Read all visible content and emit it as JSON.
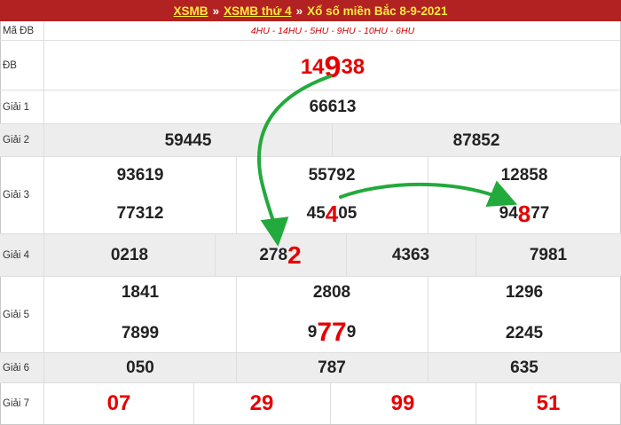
{
  "breadcrumb": {
    "home": "XSMB",
    "sep1": "»",
    "category": "XSMB thứ 4",
    "sep2": "»",
    "current": "Xổ số miền Bắc 8-9-2021"
  },
  "table": {
    "ma_db_label": "Mã ĐB",
    "ma_db_codes": "4HU - 14HU - 5HU - 9HU - 10HU - 6HU",
    "db_label": "ĐB",
    "db": {
      "pre": "14",
      "hl": "9",
      "post": "38"
    },
    "g1_label": "Giải 1",
    "g1": "66613",
    "g2_label": "Giải 2",
    "g2": [
      "59445",
      "87852"
    ],
    "g3_label": "Giải 3",
    "g3_row1": [
      "93619",
      "55792",
      "12858"
    ],
    "g3_row2": [
      "77312"
    ],
    "g3_b": {
      "pre": "45",
      "hl": "4",
      "post": "05"
    },
    "g3_c": {
      "pre": "94",
      "hl": "8",
      "post": "77"
    },
    "g4_label": "Giải 4",
    "g4_a": "0218",
    "g4_b": {
      "pre": "278",
      "hl": "2"
    },
    "g4_c": "4363",
    "g4_d": "7981",
    "g5_label": "Giải 5",
    "g5_row1": [
      "1841",
      "2808",
      "1296"
    ],
    "g5_a2": "7899",
    "g5_b2": {
      "pre": "9",
      "hl": "77",
      "post": "9"
    },
    "g5_c2": "2245",
    "g6_label": "Giải 6",
    "g6": [
      "050",
      "787",
      "635"
    ],
    "g7_label": "Giải 7",
    "g7": [
      "07",
      "29",
      "99",
      "51"
    ]
  },
  "colors": {
    "header_bg": "#b22222",
    "link": "#ffeb3b",
    "highlight": "#e60000",
    "arrow": "#22aa3c"
  }
}
